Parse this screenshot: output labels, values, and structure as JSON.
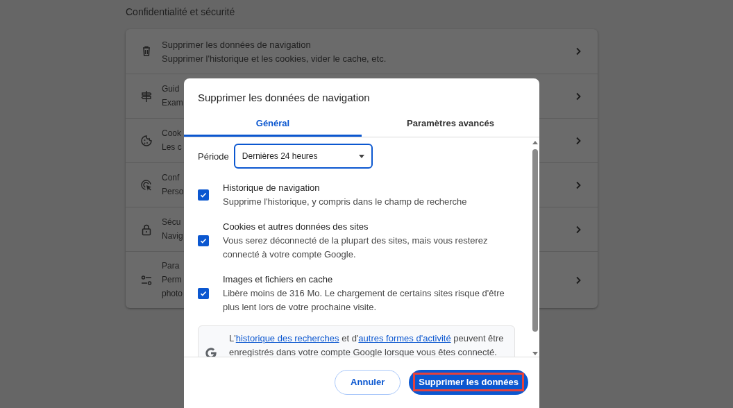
{
  "settings": {
    "heading": "Confidentialité et sécurité",
    "items": [
      {
        "title": "Supprimer les données de navigation",
        "lines": [
          "Supprimer l'historique et les cookies, vider le cache, etc."
        ]
      },
      {
        "title": "Guid",
        "lines": [
          "Exam"
        ]
      },
      {
        "title": "Cook",
        "lines": [
          "Les c"
        ]
      },
      {
        "title": "Conf",
        "lines": [
          "Perso"
        ]
      },
      {
        "title": "Sécu",
        "lines": [
          "Navig"
        ]
      },
      {
        "title": "Para",
        "lines": [
          "Perm",
          "photo"
        ]
      }
    ]
  },
  "dialog": {
    "title": "Supprimer les données de navigation",
    "tabs": [
      {
        "label": "Général",
        "selected": true
      },
      {
        "label": "Paramètres avancés",
        "selected": false
      }
    ],
    "period": {
      "label": "Période",
      "value": "Dernières 24 heures"
    },
    "options": [
      {
        "title": "Historique de navigation",
        "description": "Supprime l'historique, y compris dans le champ de recherche",
        "checked": true
      },
      {
        "title": "Cookies et autres données des sites",
        "description": "Vous serez déconnecté de la plupart des sites, mais vous resterez connecté à votre compte Google.",
        "checked": true
      },
      {
        "title": "Images et fichiers en cache",
        "description": "Libère moins de 316 Mo. Le chargement de certains sites risque d'être plus lent lors de votre prochaine visite.",
        "checked": true
      }
    ],
    "notice": [
      {
        "kind": "text",
        "text": "L'"
      },
      {
        "kind": "link",
        "text": "historique des recherches"
      },
      {
        "kind": "text",
        "text": " et d'"
      },
      {
        "kind": "link",
        "text": "autres formes d'activité"
      },
      {
        "kind": "text",
        "text": " peuvent être enregistrés dans votre compte Google lorsque vous êtes connecté."
      }
    ],
    "buttons": [
      {
        "label": "Annuler",
        "kind": "secondary",
        "highlighted": false
      },
      {
        "label": "Supprimer les données",
        "kind": "primary",
        "highlighted": true
      }
    ]
  }
}
